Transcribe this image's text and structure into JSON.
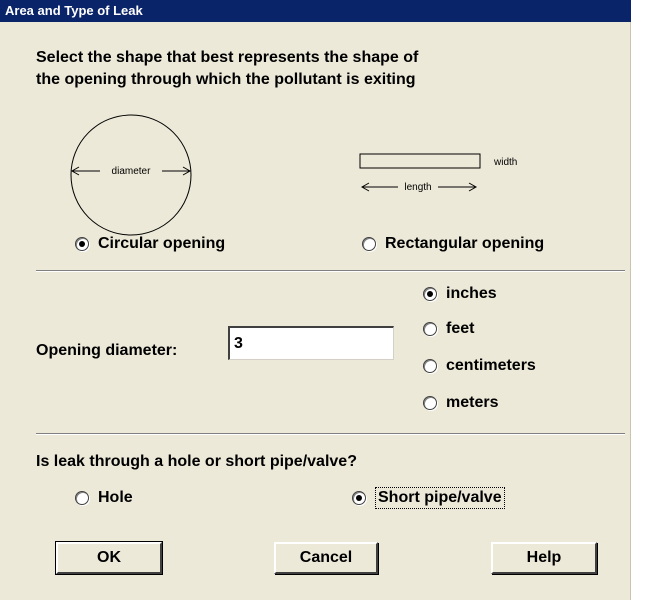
{
  "window": {
    "title": "Area and Type of Leak"
  },
  "shape_section": {
    "prompt_line1": "Select the shape that best represents the shape of",
    "prompt_line2": "the opening through which the pollutant is exiting",
    "circle_figure_label": "diameter",
    "rect_width_label": "width",
    "rect_length_label": "length",
    "circular_option": {
      "label": "Circular opening",
      "selected": true
    },
    "rectangular_option": {
      "label": "Rectangular opening",
      "selected": false
    }
  },
  "dimension_section": {
    "field_label": "Opening diameter:",
    "field_value": "3",
    "units": [
      {
        "label": "inches",
        "selected": true
      },
      {
        "label": "feet",
        "selected": false
      },
      {
        "label": "centimeters",
        "selected": false
      },
      {
        "label": "meters",
        "selected": false
      }
    ]
  },
  "leak_type_section": {
    "question": "Is leak through a hole or short pipe/valve?",
    "hole_option": {
      "label": "Hole",
      "selected": false
    },
    "pipe_option": {
      "label": "Short pipe/valve",
      "selected": true
    }
  },
  "buttons": {
    "ok": "OK",
    "cancel": "Cancel",
    "help": "Help"
  },
  "colors": {
    "title_bar": "#0a246a",
    "dialog_face": "#ece9d8"
  }
}
